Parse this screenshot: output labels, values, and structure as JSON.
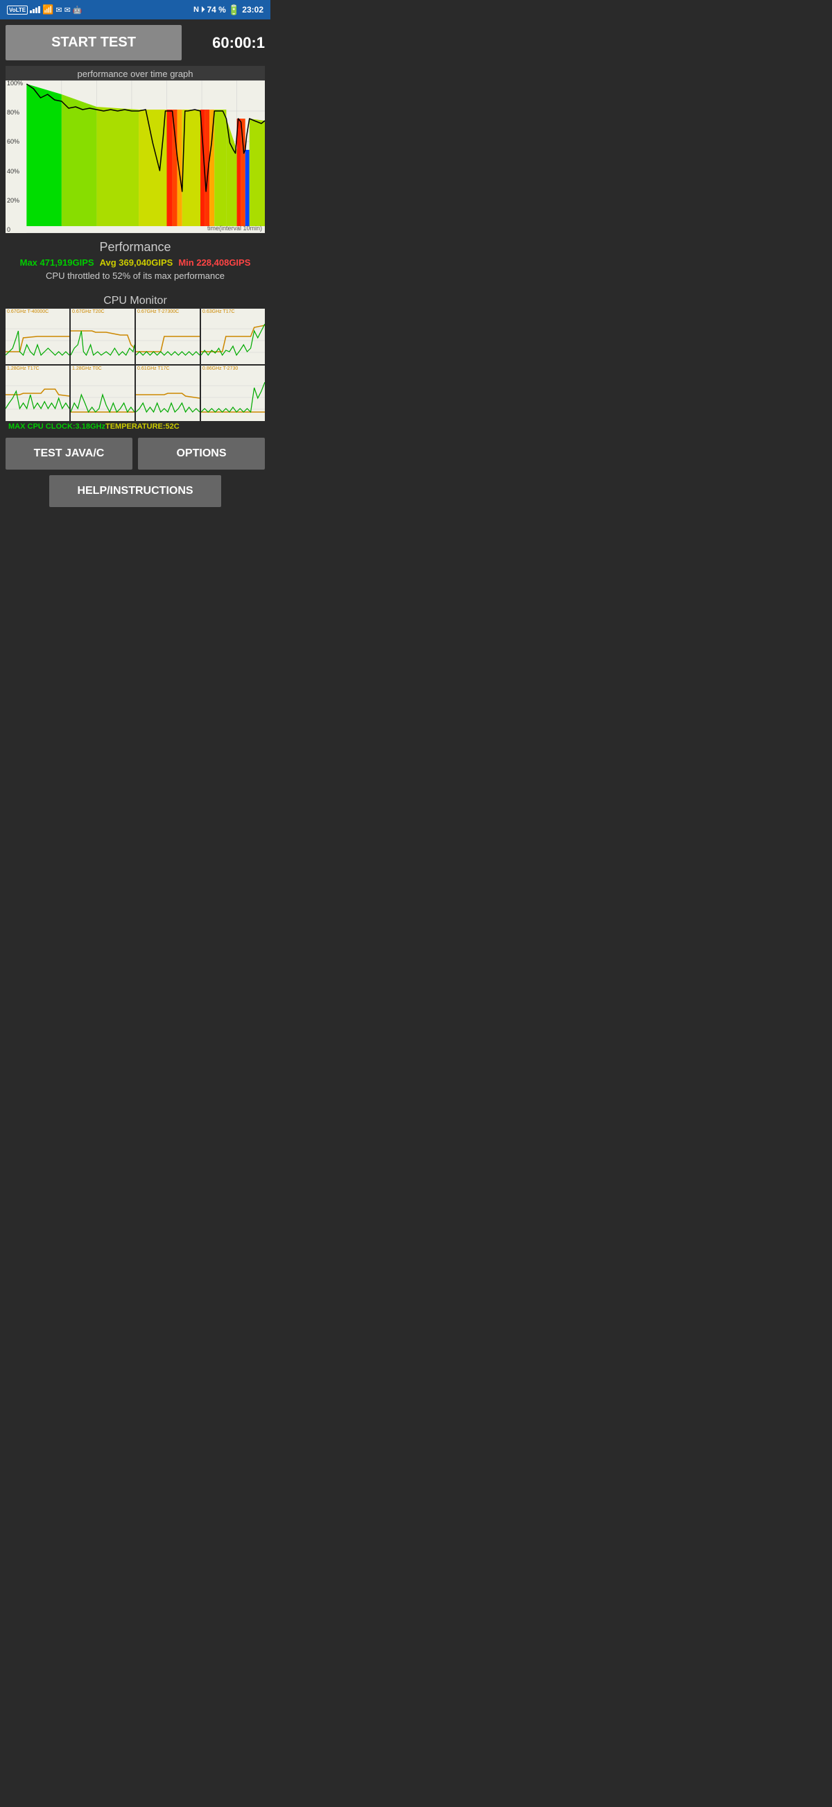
{
  "statusBar": {
    "volte": "VoLTE",
    "battery": "74 %",
    "time": "23:02"
  },
  "topRow": {
    "startButtonLabel": "START TEST",
    "timerValue": "60:00:1"
  },
  "graph": {
    "title": "performance over time graph",
    "yLabels": [
      "100%",
      "80%",
      "60%",
      "40%",
      "20%",
      "0"
    ],
    "xLabel": "time(interval 10min)"
  },
  "performance": {
    "label": "Performance",
    "max": "Max 471,919GIPS",
    "avg": "Avg 369,040GIPS",
    "min": "Min 228,408GIPS",
    "throttle": "CPU throttled to 52% of its max performance"
  },
  "cpuMonitor": {
    "title": "CPU Monitor",
    "cells": [
      {
        "header": "0.67GHz  T-40000C"
      },
      {
        "header": "0.67GHz  T20C"
      },
      {
        "header": "0.67GHz  T-27300C"
      },
      {
        "header": "0.63GHz  T17C"
      },
      {
        "header": "1.28GHz  T17C"
      },
      {
        "header": "1.28GHz  T0C"
      },
      {
        "header": "0.61GHz  T17C"
      },
      {
        "header": "0.86GHz  T-2730"
      }
    ],
    "footerClock": "MAX CPU CLOCK:3.18GHz",
    "footerTemp": "TEMPERATURE:52C"
  },
  "buttons": {
    "javaLabel": "TEST JAVA/C",
    "optionsLabel": "OPTIONS",
    "helpLabel": "HELP/INSTRUCTIONS"
  }
}
